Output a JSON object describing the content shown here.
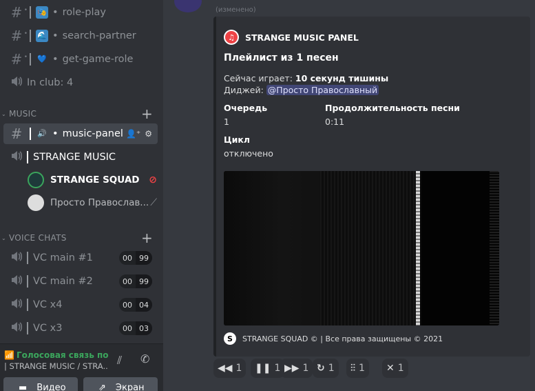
{
  "sidebar": {
    "top_channels": [
      {
        "name": "role-play",
        "emoji": "🎭"
      },
      {
        "name": "search-partner",
        "emoji": "🌊"
      },
      {
        "name": "get-game-role",
        "emoji": "💙"
      }
    ],
    "in_club": "In club: 4",
    "music_category": "MUSIC",
    "music_panel": "music-panel",
    "strange_music": "STRANGE MUSIC",
    "users": [
      {
        "name": "STRANGE SQUAD",
        "bold": true
      },
      {
        "name": "Просто Православ..."
      }
    ],
    "voice_category": "VOICE CHATS",
    "voice_channels": [
      {
        "name": "VC main #1",
        "count": "00",
        "limit": "99"
      },
      {
        "name": "VC main #2",
        "count": "00",
        "limit": "99"
      },
      {
        "name": "VC x4",
        "count": "00",
        "limit": "04"
      },
      {
        "name": "VC x3",
        "count": "00",
        "limit": "03"
      }
    ],
    "voice_status": "Голосовая связь подк",
    "voice_location": "| STRANGE MUSIC / STRA...",
    "video_label": "Видео",
    "screen_label": "Экран"
  },
  "message": {
    "edited": "(изменено)"
  },
  "embed": {
    "author": "STRANGE MUSIC PANEL",
    "title": "Плейлист из 1 песен",
    "now_playing_label": "Сейчас играет: ",
    "now_playing_value": "10 секунд тишины",
    "dj_label": "Диджей: ",
    "dj_value": "@Просто Православный",
    "queue_label": "Очередь",
    "queue_value": "1",
    "duration_label": "Продолжительность песни",
    "duration_value": "0:11",
    "loop_label": "Цикл",
    "loop_value": "отключено",
    "footer": "STRANGE SQUAD © | Все права защищены © 2021",
    "accent_color": "#202225"
  },
  "reactions": [
    {
      "icon": "rewind-icon",
      "glyph": "◀◀",
      "count": "1"
    },
    {
      "icon": "pause-icon",
      "glyph": "❚❚",
      "count": "1"
    },
    {
      "icon": "forward-icon",
      "glyph": "▶▶",
      "count": "1"
    },
    {
      "icon": "repeat-icon",
      "glyph": "↻",
      "count": "1"
    },
    {
      "icon": "equalizer-icon",
      "glyph": "⫶⫶",
      "count": "1"
    },
    {
      "icon": "close-icon",
      "glyph": "✕",
      "count": "1"
    }
  ]
}
